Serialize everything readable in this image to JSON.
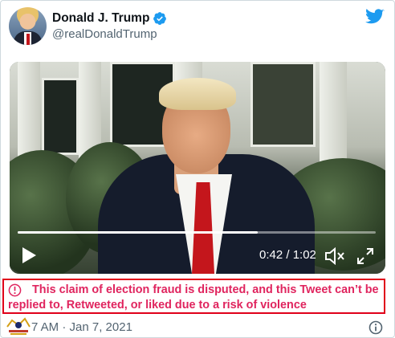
{
  "author": {
    "display_name": "Donald J. Trump",
    "handle": "@realDonaldTrump",
    "verified": true
  },
  "brand": {
    "icon": "twitter-bird-icon",
    "color": "#1d9bf0"
  },
  "video": {
    "current_time": "0:42",
    "duration": "1:02",
    "time_label": "0:42 / 1:02",
    "progress": 0.67
  },
  "warning": {
    "icon": "alert-circle-icon",
    "text": "This claim of election fraud is disputed, and this Tweet can’t be replied to, Retweeted, or liked due to a risk of violence",
    "color": "#e0245e",
    "border_color": "#e0001a"
  },
  "footer": {
    "timestamp": "7 AM · Jan 7, 2021",
    "info_icon": "info-icon"
  }
}
